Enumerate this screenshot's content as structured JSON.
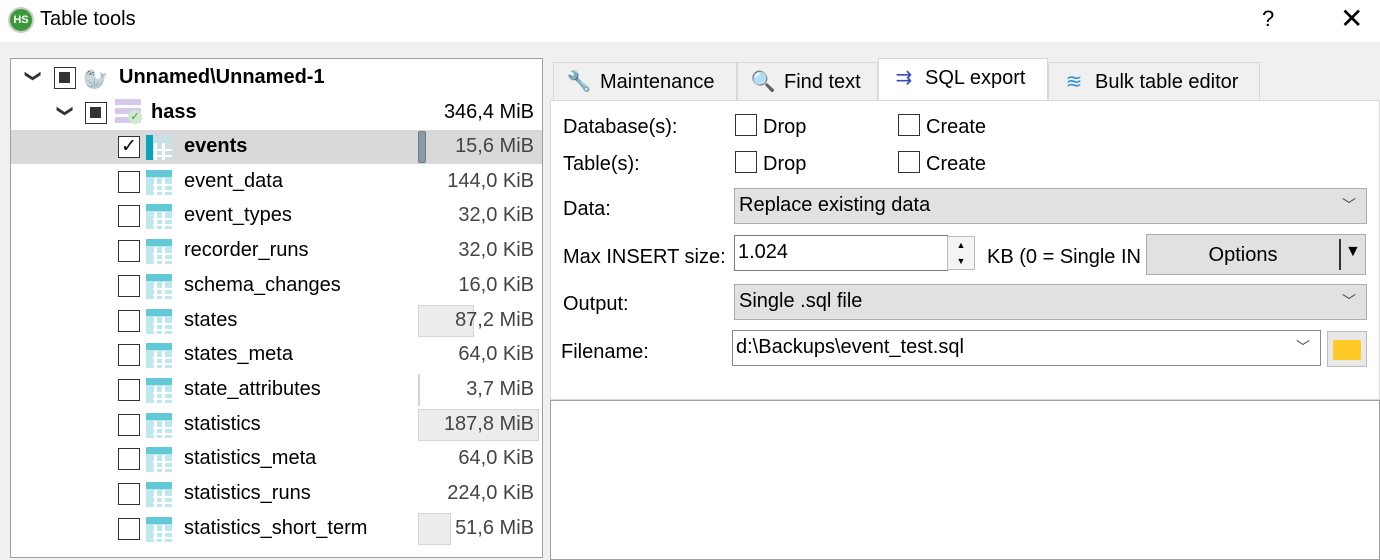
{
  "window": {
    "title": "Table tools",
    "logo": "HS",
    "help": "?",
    "close": "✕"
  },
  "tree": {
    "server": {
      "label": "Unnamed\\Unnamed-1",
      "icon": "seal-icon"
    },
    "database": {
      "label": "hass",
      "size": "346,4 MiB"
    },
    "tables": [
      {
        "name": "events",
        "size": "15,6 MiB",
        "checked": true,
        "selected": true,
        "fraction": 0.083
      },
      {
        "name": "event_data",
        "size": "144,0 KiB",
        "checked": false,
        "fraction": 0
      },
      {
        "name": "event_types",
        "size": "32,0 KiB",
        "checked": false,
        "fraction": 0
      },
      {
        "name": "recorder_runs",
        "size": "32,0 KiB",
        "checked": false,
        "fraction": 0
      },
      {
        "name": "schema_changes",
        "size": "16,0 KiB",
        "checked": false,
        "fraction": 0
      },
      {
        "name": "states",
        "size": "87,2 MiB",
        "checked": false,
        "fraction": 0.464
      },
      {
        "name": "states_meta",
        "size": "64,0 KiB",
        "checked": false,
        "fraction": 0
      },
      {
        "name": "state_attributes",
        "size": "3,7 MiB",
        "checked": false,
        "fraction": 0.02
      },
      {
        "name": "statistics",
        "size": "187,8 MiB",
        "checked": false,
        "fraction": 1.0
      },
      {
        "name": "statistics_meta",
        "size": "64,0 KiB",
        "checked": false,
        "fraction": 0
      },
      {
        "name": "statistics_runs",
        "size": "224,0 KiB",
        "checked": false,
        "fraction": 0
      },
      {
        "name": "statistics_short_term",
        "size": "51,6 MiB",
        "checked": false,
        "fraction": 0.275
      }
    ]
  },
  "tabs": [
    {
      "label": "Maintenance",
      "icon": "wrench-icon"
    },
    {
      "label": "Find text",
      "icon": "magnifier-icon"
    },
    {
      "label": "SQL export",
      "icon": "export-arrow-icon",
      "active": true
    },
    {
      "label": "Bulk table editor",
      "icon": "layers-icon"
    }
  ],
  "form": {
    "databases_label": "Database(s):",
    "tables_label": "Table(s):",
    "drop": "Drop",
    "create": "Create",
    "data_label": "Data:",
    "data_value": "Replace existing data",
    "max_insert_label": "Max INSERT size:",
    "max_insert_value": "1.024",
    "max_insert_hint": "KB (0 = Single IN",
    "options": "Options",
    "output_label": "Output:",
    "output_value": "Single .sql file",
    "filename_label": "Filename:",
    "filename_value": "d:\\Backups\\event_test.sql"
  }
}
